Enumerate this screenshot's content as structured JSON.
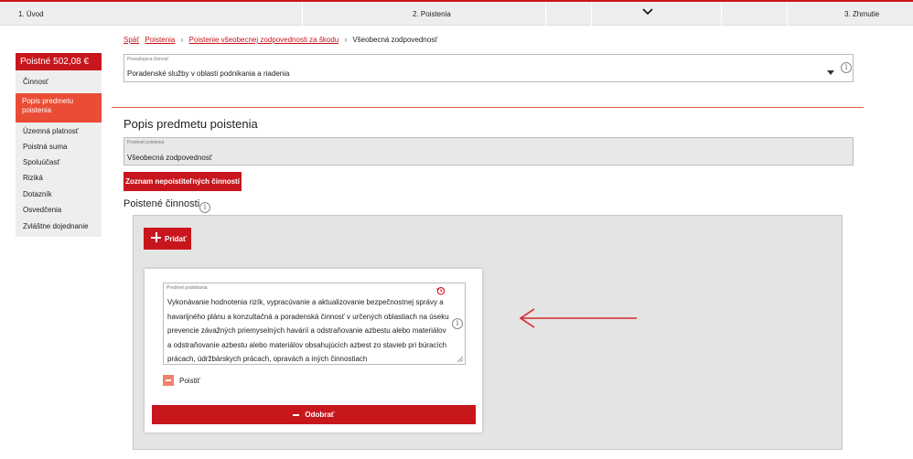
{
  "steps": [
    "1. Úvod",
    "2. Poistenia",
    "3. Zhrnutie"
  ],
  "sidebar": {
    "premium": "Poistné 502,08 €",
    "items": [
      {
        "label": "Činnosť"
      },
      {
        "label": "Popis predmetu poistenia",
        "active": true
      },
      {
        "label": "Územná platnosť"
      },
      {
        "label": "Poistná suma"
      },
      {
        "label": "Spoluúčasť"
      },
      {
        "label": "Riziká"
      },
      {
        "label": "Dotazník"
      },
      {
        "label": "Osvedčenia"
      },
      {
        "label": "Zvláštne dojednanie"
      }
    ]
  },
  "breadcrumb": {
    "back": "Späť",
    "links": [
      "Poistenia",
      "Poistenie všeobecnej zodpovednosti za škodu"
    ],
    "current": "Všeobecná zodpovednosť"
  },
  "main_activity": {
    "label": "Prevažujúca činnosť",
    "value": "Poradenské služby v oblasti podnikania a riadenia"
  },
  "section_title": "Popis predmetu poistenia",
  "insured_object": {
    "label": "Predmet poistenia",
    "value": "Všeobecná zodpovednosť"
  },
  "uninsurable_button": "Zoznam nepoistiteľných činností",
  "insured_activities": {
    "title": "Poistené činnosti",
    "add_button": "Pridať",
    "card": {
      "field_label": "Predmet podnikania",
      "lines": [
        "Vykonávanie hodnotenia rizík, vypracúvanie a aktualizovanie bezpečnostnej správy a",
        "havarijného plánu a konzultačná a poradenská činnosť v určených oblastiach na úseku",
        "prevencie závažných priemyselných havárií a odstraňovanie azbestu alebo materiálov",
        "a odstraňovanie azbestu alebo materiálov obsahujúcich azbest zo stavieb pri búracích",
        "prácach, údržbárskych prácach, opravách a iných činnostiach"
      ],
      "checkbox_label": "Poistiť",
      "remove_button": "Odobrať"
    }
  },
  "colors": {
    "brand_red": "#c8161d",
    "active_orange": "#ea4c35",
    "panel_grey": "#e4e4e4",
    "checkbox": "#f0836f"
  }
}
